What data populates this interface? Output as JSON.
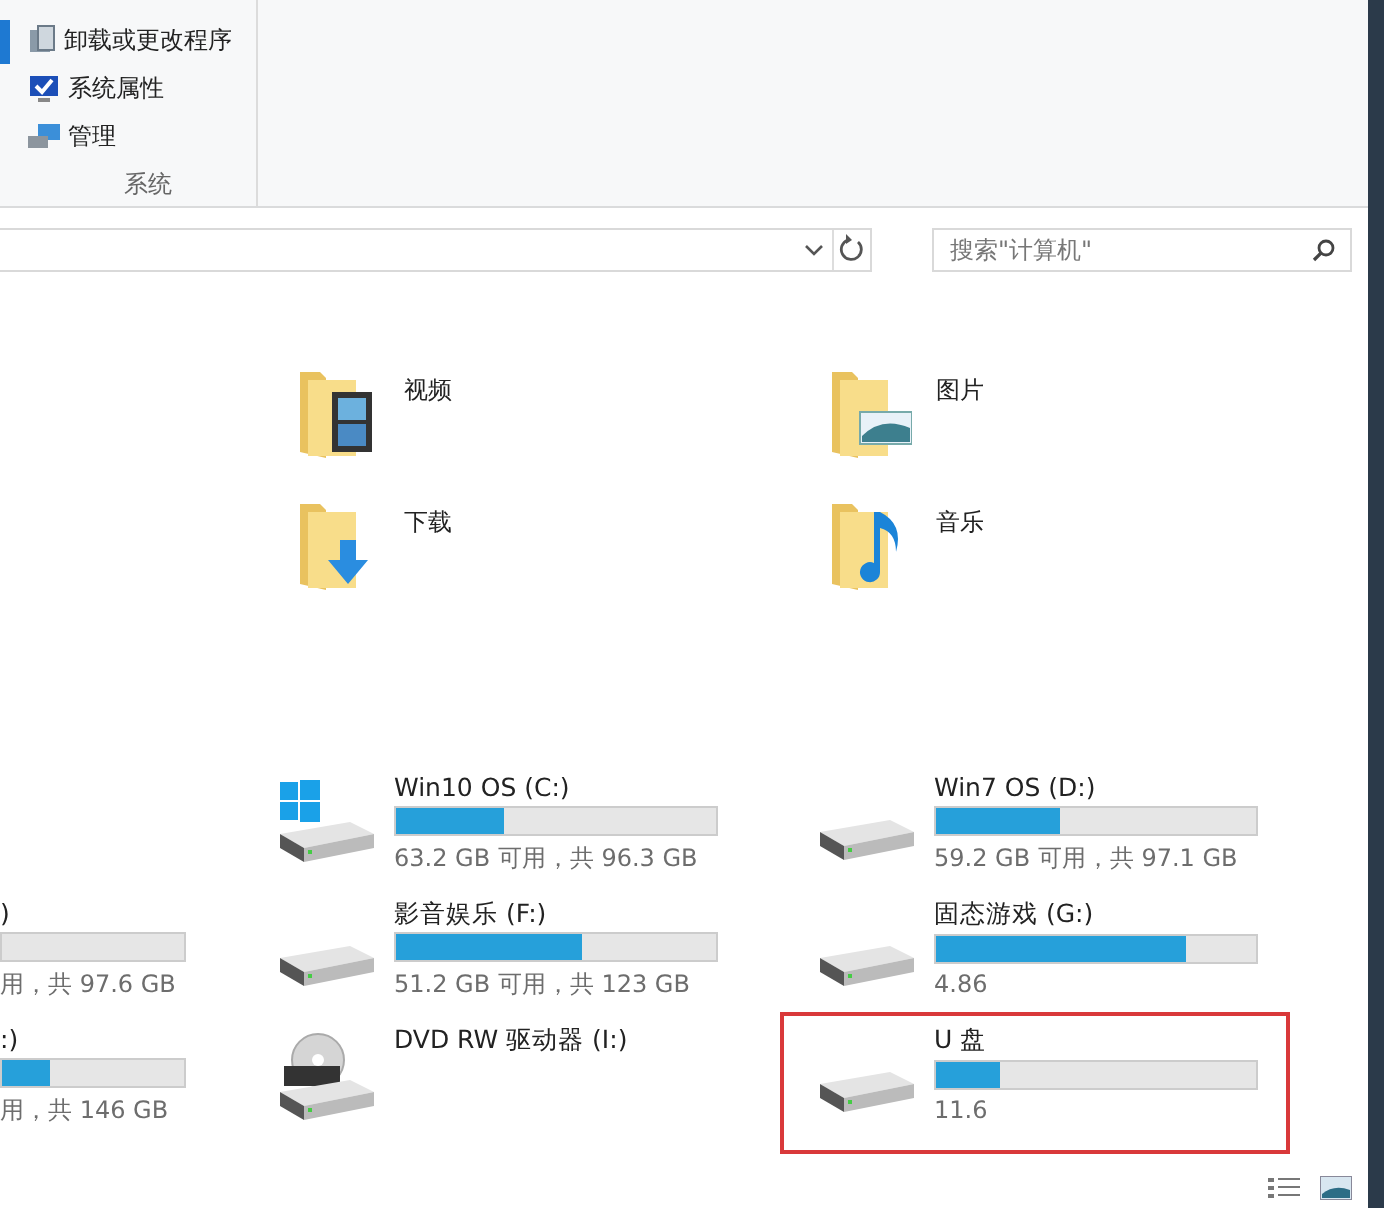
{
  "ribbon": {
    "items": [
      {
        "label": "卸载或更改程序",
        "kind": "uninstall"
      },
      {
        "label": "系统属性",
        "kind": "properties"
      },
      {
        "label": "管理",
        "kind": "manage"
      }
    ],
    "group_label": "系统"
  },
  "address_bar": {
    "search_placeholder": "搜索\"计算机\""
  },
  "folders": [
    {
      "name": "视频",
      "kind": "video"
    },
    {
      "name": "图片",
      "kind": "pictures"
    },
    {
      "name": "下载",
      "kind": "downloads"
    },
    {
      "name": "音乐",
      "kind": "music"
    }
  ],
  "drives": [
    {
      "name": "Win10 OS (C:)",
      "kind": "system",
      "level": 0.34,
      "size": "63.2 GB 可用，共 96.3 GB",
      "highlighted": false
    },
    {
      "name": "Win7 OS (D:)",
      "kind": "disk",
      "level": 0.39,
      "size": "59.2 GB 可用，共 97.1 GB",
      "highlighted": false
    },
    {
      "name": ")",
      "kind": "partial",
      "size": "用，共 97.6 GB",
      "highlighted": false
    },
    {
      "name": "影音娱乐 (F:)",
      "kind": "disk",
      "level": 0.58,
      "size": "51.2 GB 可用，共 123 GB",
      "highlighted": false
    },
    {
      "name": "固态游戏 (G:)",
      "kind": "disk",
      "level": 0.78,
      "size": "4.86",
      "highlighted": false
    },
    {
      "name": ":)",
      "kind": "partial",
      "level": 0.26,
      "size": "用，共 146 GB",
      "highlighted": false
    },
    {
      "name": "DVD RW 驱动器 (I:)",
      "kind": "dvd",
      "highlighted": false
    },
    {
      "name": "U 盘",
      "kind": "disk",
      "level": 0.2,
      "size": "11.6",
      "highlighted": true
    }
  ]
}
